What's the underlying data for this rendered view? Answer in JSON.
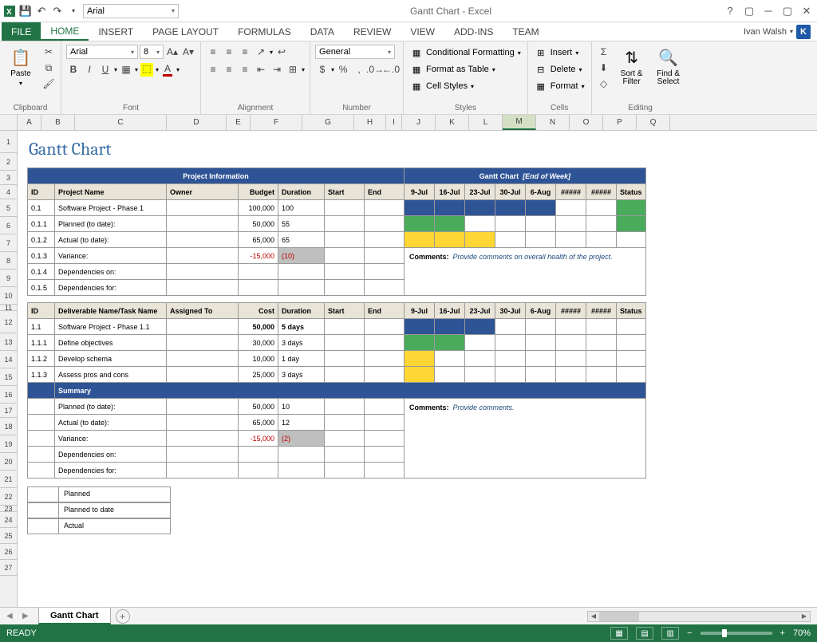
{
  "titlebar": {
    "font": "Arial",
    "title": "Gantt Chart - Excel"
  },
  "tabs": {
    "file": "FILE",
    "home": "HOME",
    "insert": "INSERT",
    "pagelayout": "PAGE LAYOUT",
    "formulas": "FORMULAS",
    "data": "DATA",
    "review": "REVIEW",
    "view": "VIEW",
    "addins": "ADD-INS",
    "team": "TEAM",
    "user": "Ivan Walsh",
    "userbadge": "K"
  },
  "ribbon": {
    "clipboard": {
      "paste": "Paste",
      "label": "Clipboard"
    },
    "font": {
      "name": "Arial",
      "size": "8",
      "label": "Font"
    },
    "alignment": {
      "label": "Alignment"
    },
    "number": {
      "format": "General",
      "label": "Number"
    },
    "styles": {
      "cf": "Conditional Formatting",
      "fat": "Format as Table",
      "cs": "Cell Styles",
      "label": "Styles"
    },
    "cells": {
      "insert": "Insert",
      "delete": "Delete",
      "format": "Format",
      "label": "Cells"
    },
    "editing": {
      "sort": "Sort & Filter",
      "find": "Find & Select",
      "label": "Editing"
    }
  },
  "columns": [
    "A",
    "B",
    "C",
    "D",
    "E",
    "F",
    "G",
    "H",
    "I",
    "J",
    "K",
    "L",
    "M",
    "N",
    "O",
    "P",
    "Q"
  ],
  "selectedCol": "M",
  "sheet": {
    "title": "Gantt Chart",
    "section1": "Project Information",
    "section2": "Gantt Chart",
    "section2sub": "[End of Week]",
    "hdr1": {
      "id": "ID",
      "name": "Project Name",
      "owner": "Owner",
      "budget": "Budget",
      "dur": "Duration",
      "start": "Start",
      "end": "End",
      "status": "Status"
    },
    "weeks": [
      "9-Jul",
      "16-Jul",
      "23-Jul",
      "30-Jul",
      "6-Aug",
      "#####",
      "#####"
    ],
    "rows1": [
      {
        "id": "0.1",
        "name": "Software Project - Phase 1",
        "budget": "100,000",
        "dur": "100",
        "bars": [
          "blue",
          "blue",
          "blue",
          "blue",
          "blue",
          "",
          ""
        ],
        "status": "green"
      },
      {
        "id": "0.1.1",
        "name": "Planned (to date):",
        "budget": "50,000",
        "dur": "55",
        "bars": [
          "green",
          "green",
          "",
          "",
          "",
          "",
          ""
        ],
        "status": "green"
      },
      {
        "id": "0.1.2",
        "name": "Actual (to date):",
        "budget": "65,000",
        "dur": "65",
        "bars": [
          "yellow",
          "yellow",
          "yellow",
          "",
          "",
          "",
          ""
        ],
        "status": ""
      },
      {
        "id": "0.1.3",
        "name": "Variance:",
        "budget": "-15,000",
        "dur": "(10)",
        "neg": true,
        "grey": true
      },
      {
        "id": "0.1.4",
        "name": "Dependencies on:"
      },
      {
        "id": "0.1.5",
        "name": "Dependencies for:"
      }
    ],
    "comments1lbl": "Comments:",
    "comments1": "Provide comments on overall health of the project.",
    "hdr2": {
      "id": "ID",
      "name": "Deliverable Name/Task Name",
      "owner": "Assigned To",
      "budget": "Cost",
      "dur": "Duration",
      "start": "Start",
      "end": "End",
      "status": "Status"
    },
    "rows2": [
      {
        "id": "1.1",
        "name": "Software Project - Phase 1.1",
        "budget": "50,000",
        "dur": "5 days",
        "bold": true,
        "bars": [
          "blue",
          "blue",
          "blue",
          "",
          "",
          "",
          ""
        ]
      },
      {
        "id": "1.1.1",
        "name": "Define objectives",
        "budget": "30,000",
        "dur": "3 days",
        "bars": [
          "green",
          "green",
          "",
          "",
          "",
          "",
          ""
        ]
      },
      {
        "id": "1.1.2",
        "name": "Develop schema",
        "budget": "10,000",
        "dur": "1 day",
        "bars": [
          "yellow",
          "",
          "",
          "",
          "",
          "",
          ""
        ]
      },
      {
        "id": "1.1.3",
        "name": "Assess pros and cons",
        "budget": "25,000",
        "dur": "3 days",
        "bars": [
          "yellow",
          "",
          "",
          "",
          "",
          "",
          ""
        ]
      }
    ],
    "summary": "Summary",
    "rows3": [
      {
        "name": "Planned (to date):",
        "budget": "50,000",
        "dur": "10"
      },
      {
        "name": "Actual (to date):",
        "budget": "65,000",
        "dur": "12"
      },
      {
        "name": "Variance:",
        "budget": "-15,000",
        "dur": "(2)",
        "neg": true,
        "grey": true
      },
      {
        "name": "Dependencies on:"
      },
      {
        "name": "Dependencies for:"
      }
    ],
    "comments2lbl": "Comments:",
    "comments2": "Provide comments.",
    "legend": [
      {
        "color": "blue",
        "label": "Planned"
      },
      {
        "color": "green",
        "label": "Planned to date"
      },
      {
        "color": "yellow",
        "label": "Actual"
      }
    ]
  },
  "sheettab": "Gantt Chart",
  "status": {
    "ready": "READY",
    "zoom": "70%"
  }
}
